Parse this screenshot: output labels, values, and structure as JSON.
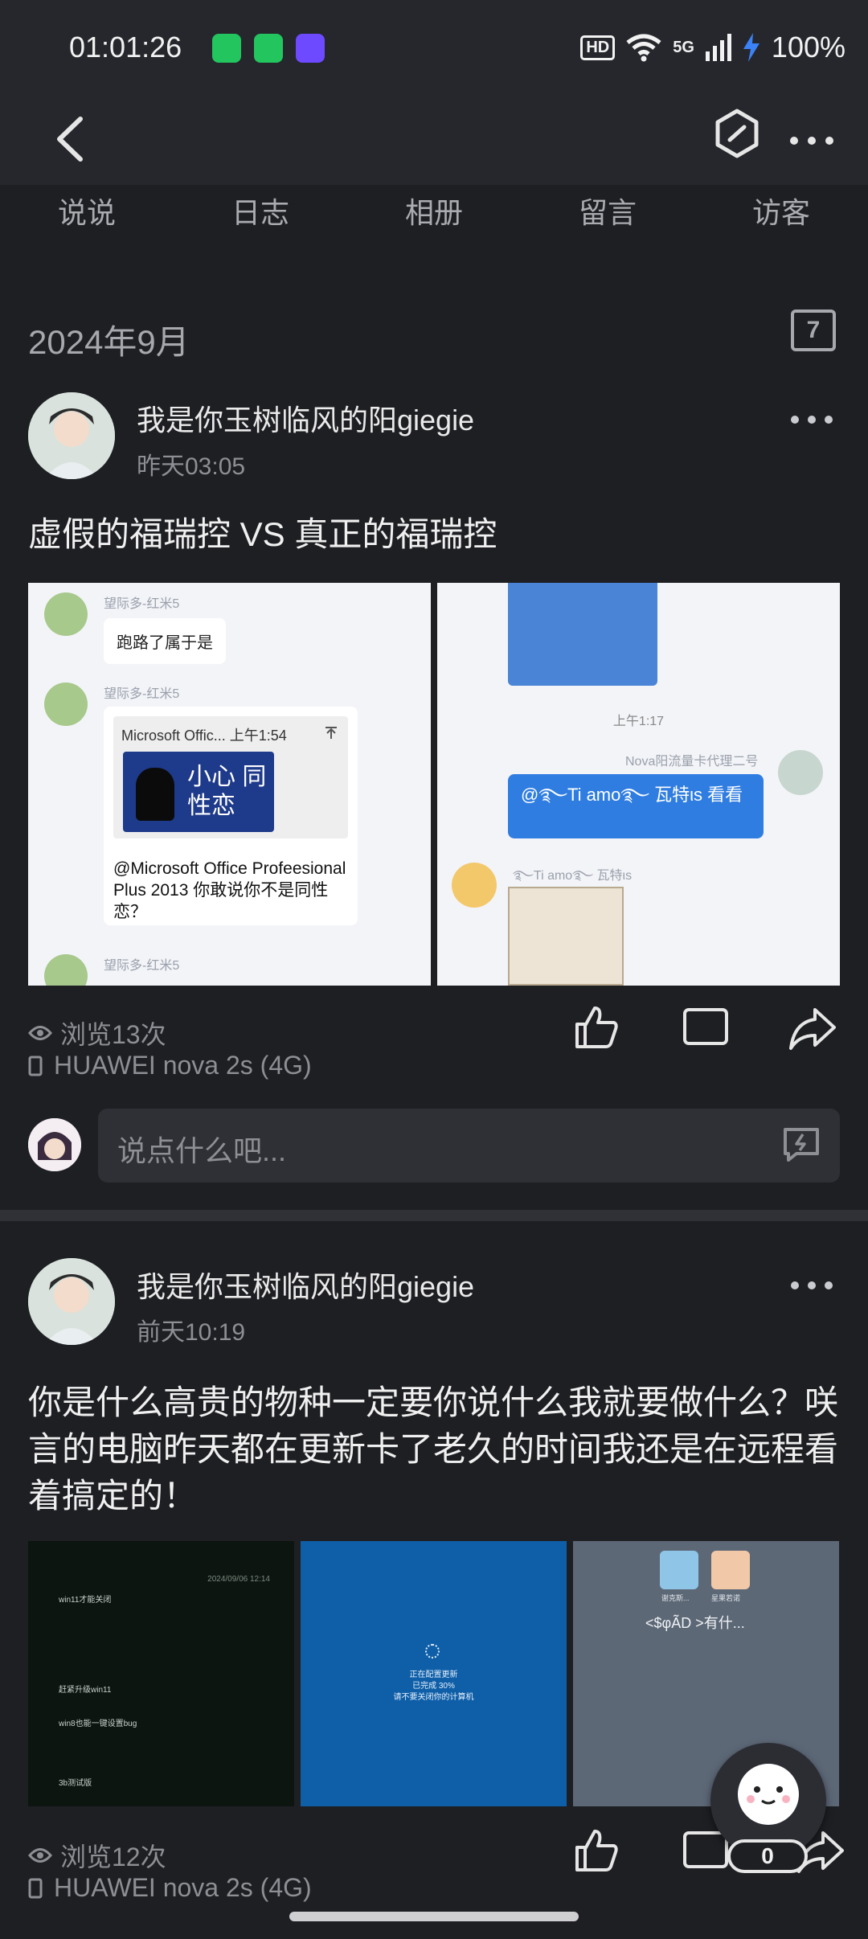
{
  "status": {
    "time": "01:01:26",
    "network": "5G",
    "battery": "100%",
    "hd": "HD"
  },
  "tabs": [
    "说说",
    "日志",
    "相册",
    "留言",
    "访客"
  ],
  "month": "2024年9月",
  "calendar_day": "7",
  "posts": [
    {
      "author": "我是你玉树临风的阳giegie",
      "time": "昨天03:05",
      "text": "虚假的福瑞控 VS 真正的福瑞控",
      "views": "浏览13次",
      "device": "HUAWEI nova 2s (4G)",
      "images": [
        {
          "sender1": "望际多-红米5",
          "msg1": "跑路了属于是",
          "sender2": "望际多-红米5",
          "card_title": "Microsoft Offic... 上午1:54",
          "card_sticker": "小心 同性恋",
          "card_text": "@Microsoft Office Profeesional Plus 2013 你敢说你不是同性恋？",
          "sender3": "望际多-红米5"
        },
        {
          "time": "上午1:17",
          "sender": "Nova阳流量卡代理二号",
          "bubble": "@࿐Ti amo࿐ 瓦特ιѕ 看看",
          "reply_name": "࿐Ti amo࿐ 瓦特ιѕ"
        }
      ]
    },
    {
      "author": "我是你玉树临风的阳giegie",
      "time": "前天10:19",
      "text": "你是什么高贵的物种一定要你说什么我就要做什么？咲言的电脑昨天都在更新卡了老久的时间我还是在远程看着搞定的！",
      "views": "浏览12次",
      "device": "HUAWEI nova 2s (4G)",
      "images": [
        {
          "chat": [
            "win11才能关闭",
            "赶紧升级win11",
            "win8也能一键设置bug",
            "3b测试版"
          ],
          "date": "2024/09/06 12:14"
        },
        {
          "update_line1": "正在配置更新",
          "update_line2": "已完成 30%",
          "update_line3": "请不要关闭你的计算机"
        },
        {
          "label1": "谢克斯...",
          "label2": "星果若诺",
          "text": "<$φÃD >有什..."
        }
      ]
    }
  ],
  "comment_placeholder": "说点什么吧...",
  "floating_count": "0"
}
